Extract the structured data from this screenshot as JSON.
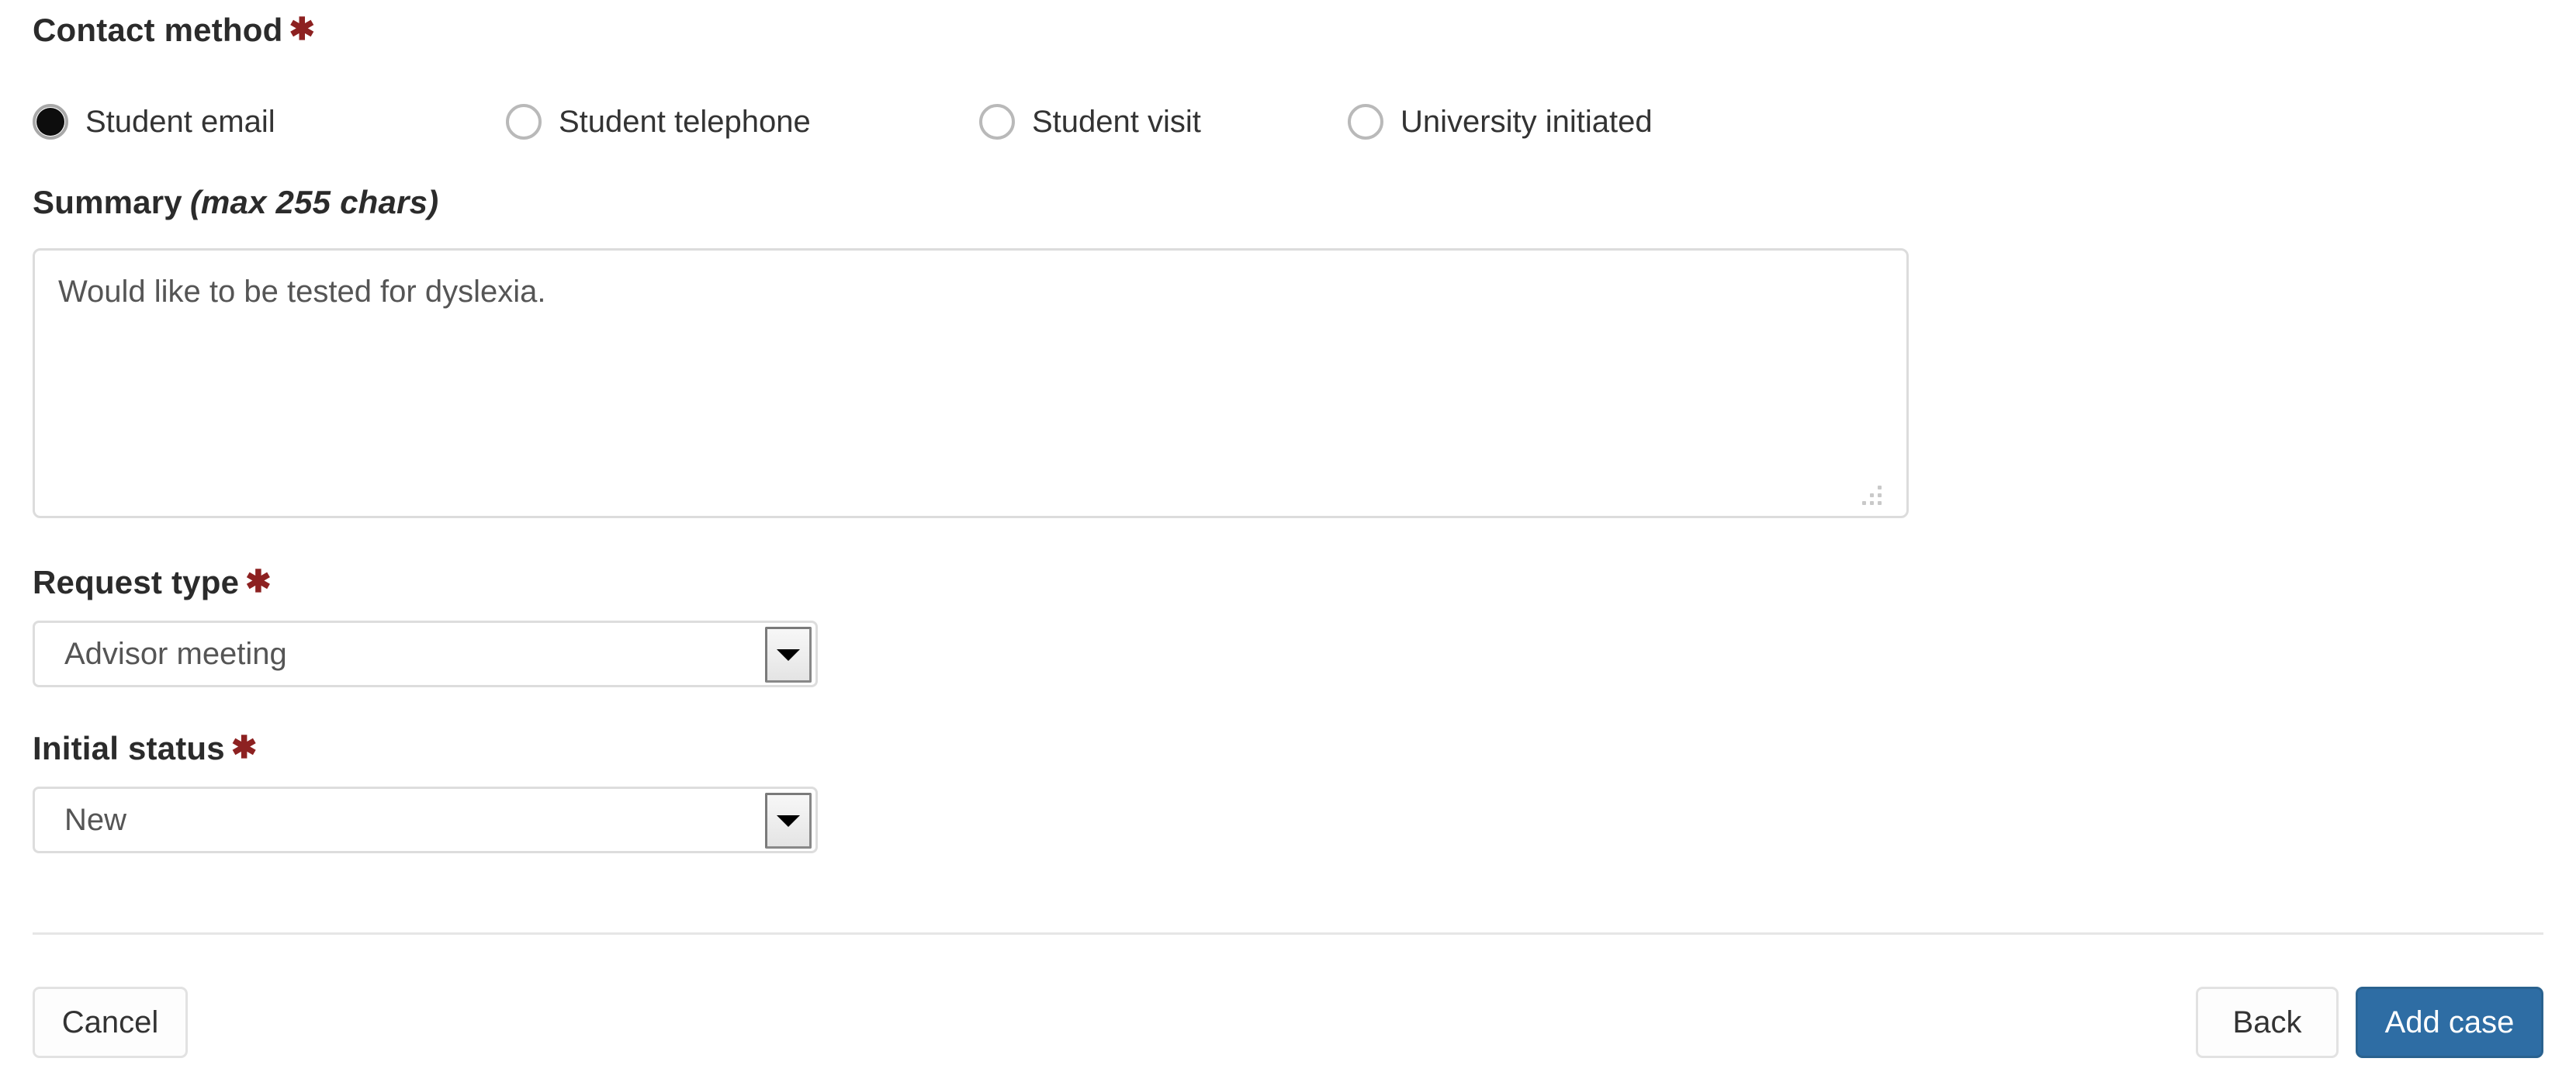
{
  "form": {
    "contact_method": {
      "label": "Contact method",
      "required_marker": "✱",
      "options": [
        {
          "label": "Student email",
          "selected": true
        },
        {
          "label": "Student telephone",
          "selected": false
        },
        {
          "label": "Student visit",
          "selected": false
        },
        {
          "label": "University initiated",
          "selected": false
        }
      ]
    },
    "summary": {
      "label": "Summary",
      "hint": "(max 255 chars)",
      "value": "Would like to be tested for dyslexia.",
      "placeholder": ""
    },
    "request_type": {
      "label": "Request type",
      "required_marker": "✱",
      "value": "Advisor meeting"
    },
    "initial_status": {
      "label": "Initial status",
      "required_marker": "✱",
      "value": "New"
    }
  },
  "footer": {
    "cancel_label": "Cancel",
    "back_label": "Back",
    "add_case_label": "Add case"
  },
  "colors": {
    "required_asterisk": "#8d2121",
    "primary_button": "#2e6da4",
    "text": "#333333",
    "label_text": "#2b2b2b",
    "border": "#dddddd",
    "divider": "#e6e6e6"
  }
}
